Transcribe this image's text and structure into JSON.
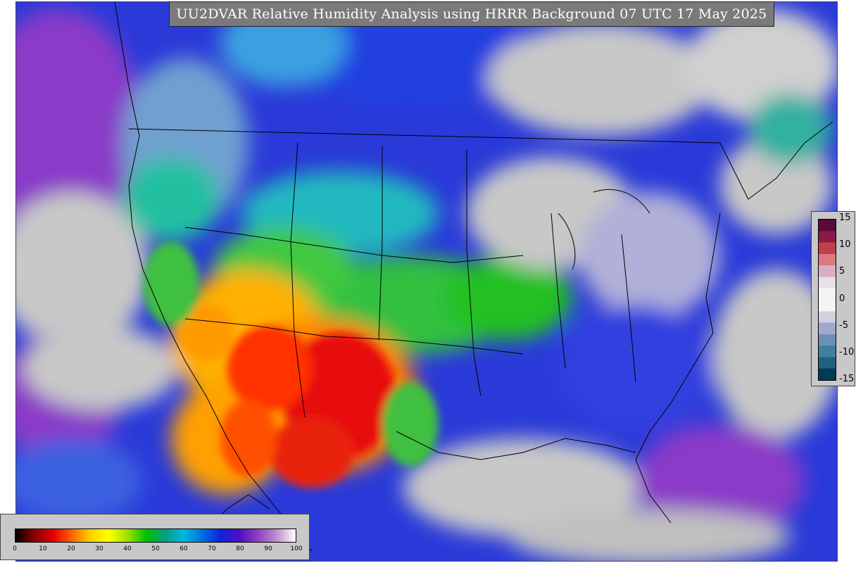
{
  "map": {
    "title": "UU2DVAR Relative Humidity Analysis using HRRR Background 07 UTC 17 May 2025",
    "colors": {
      "dry_red": "#e00000",
      "orange": "#ff8c00",
      "yellow": "#ffff00",
      "green": "#00c000",
      "cyan": "#00b0c0",
      "blue": "#1020e0",
      "purple": "#8a2be2",
      "gray_saturated": "#c8c8c8"
    }
  },
  "legend_rh": {
    "labels": [
      "0",
      "10",
      "20",
      "30",
      "40",
      "50",
      "60",
      "70",
      "80",
      "90",
      "100"
    ],
    "colors": [
      "#000000",
      "#8b0000",
      "#e00000",
      "#ff6000",
      "#ffd000",
      "#ffff00",
      "#a0e000",
      "#00c000",
      "#00a080",
      "#00b8e0",
      "#0070e0",
      "#1020e0",
      "#5010c0",
      "#9040c0",
      "#c090d0",
      "#ffffff"
    ]
  },
  "legend_increment": {
    "labels": [
      "15",
      "10",
      "5",
      "0",
      "-5",
      "-10",
      "-15"
    ],
    "colors": [
      "#5a0a3a",
      "#8b1a4a",
      "#c0404a",
      "#d87a80",
      "#d8b0c0",
      "#e8e0e8",
      "#f4f4f4",
      "#f4f4f4",
      "#d0d0e0",
      "#a0a8d0",
      "#6a90b8",
      "#40809a",
      "#206080",
      "#003a5a"
    ]
  }
}
